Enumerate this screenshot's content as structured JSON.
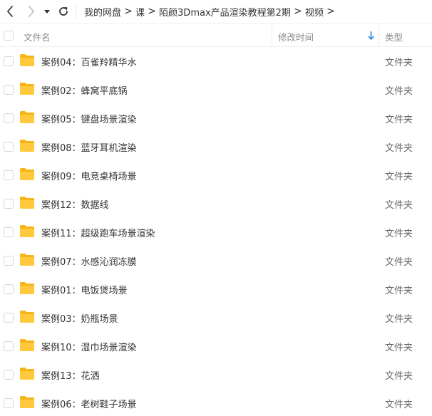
{
  "navbar": {
    "back_icon": "chevron-left-icon",
    "forward_icon": "chevron-right-icon",
    "dropdown_icon": "caret-down-icon",
    "refresh_icon": "refresh-icon",
    "breadcrumb": [
      "我的网盘",
      "课",
      "陌颜3Dmax产品渲染教程第2期",
      "视频"
    ],
    "breadcrumb_separator": ">"
  },
  "header": {
    "name_label": "文件名",
    "time_label": "修改时间",
    "type_label": "类型",
    "sort_icon": "sort-down-arrow-icon",
    "sort_color": "#1e88e5"
  },
  "folder_color": "#ffc83d",
  "files": [
    {
      "name": "案例04：百雀羚精华水",
      "time": "",
      "type": "文件夹"
    },
    {
      "name": "案例02：蜂窝平底锅",
      "time": "",
      "type": "文件夹"
    },
    {
      "name": "案例05：键盘场景渲染",
      "time": "",
      "type": "文件夹"
    },
    {
      "name": "案例08：蓝牙耳机渲染",
      "time": "",
      "type": "文件夹"
    },
    {
      "name": "案例09：电竞桌椅场景",
      "time": "",
      "type": "文件夹"
    },
    {
      "name": "案例12：数据线",
      "time": "",
      "type": "文件夹"
    },
    {
      "name": "案例11：超级跑车场景渲染",
      "time": "",
      "type": "文件夹"
    },
    {
      "name": "案例07：水感沁润冻膜",
      "time": "",
      "type": "文件夹"
    },
    {
      "name": "案例01：电饭煲场景",
      "time": "",
      "type": "文件夹"
    },
    {
      "name": "案例03：奶瓶场景",
      "time": "",
      "type": "文件夹"
    },
    {
      "name": "案例10：湿巾场景渲染",
      "time": "",
      "type": "文件夹"
    },
    {
      "name": "案例13：花洒",
      "time": "",
      "type": "文件夹"
    },
    {
      "name": "案例06：老树鞋子场景",
      "time": "",
      "type": "文件夹"
    }
  ]
}
